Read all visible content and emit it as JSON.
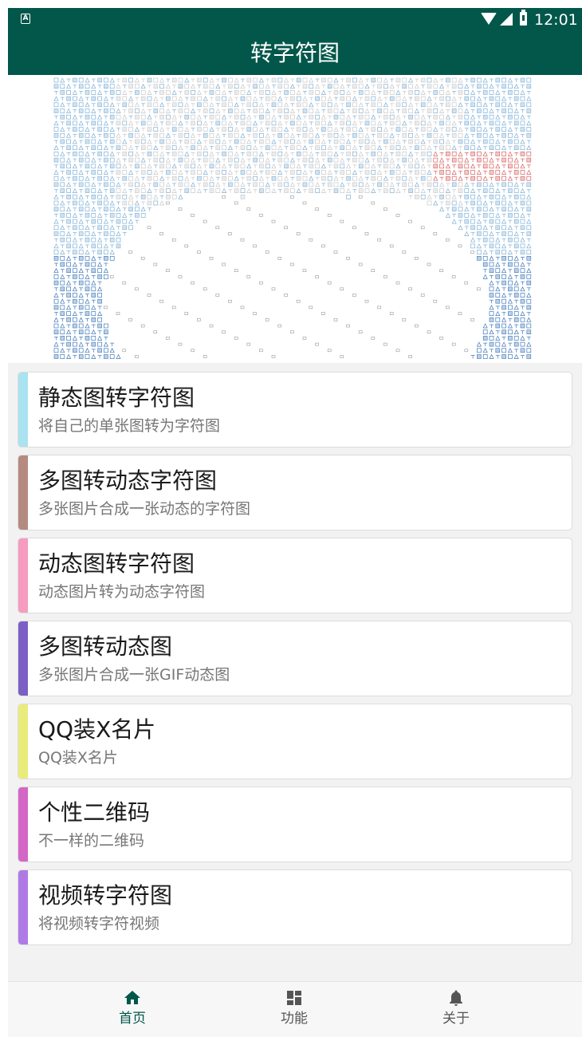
{
  "status_bar": {
    "notification_icon": "A",
    "time": "12:01",
    "icons": [
      "wifi-icon",
      "cell-signal-icon",
      "battery-icon"
    ]
  },
  "app_bar": {
    "title": "转字符图"
  },
  "banner": {
    "icon": "ascii-art-preview-image"
  },
  "menu": [
    {
      "title": "静态图转字符图",
      "subtitle": "将自己的单张图转为字符图",
      "accent": "#a9e2f0"
    },
    {
      "title": "多图转动态字符图",
      "subtitle": "多张图片合成一张动态的字符图",
      "accent": "#b58a80"
    },
    {
      "title": "动态图转字符图",
      "subtitle": "动态图片转为动态字符图",
      "accent": "#f59cbf"
    },
    {
      "title": "多图转动态图",
      "subtitle": "多张图片合成一张GIF动态图",
      "accent": "#7c5fc4"
    },
    {
      "title": "QQ装X名片",
      "subtitle": "QQ装X名片",
      "accent": "#e8ec7a"
    },
    {
      "title": "个性二维码",
      "subtitle": "不一样的二维码",
      "accent": "#d466c6"
    },
    {
      "title": "视频转字符图",
      "subtitle": "将视频转字符视频",
      "accent": "#b07ae6"
    }
  ],
  "bottom_nav": [
    {
      "label": "首页",
      "icon": "home-icon",
      "active": true
    },
    {
      "label": "功能",
      "icon": "dashboard-icon",
      "active": false
    },
    {
      "label": "关于",
      "icon": "bell-icon",
      "active": false
    }
  ],
  "colors": {
    "primary": "#02574a",
    "background": "#f2f2f2",
    "active_nav": "#02574a"
  }
}
